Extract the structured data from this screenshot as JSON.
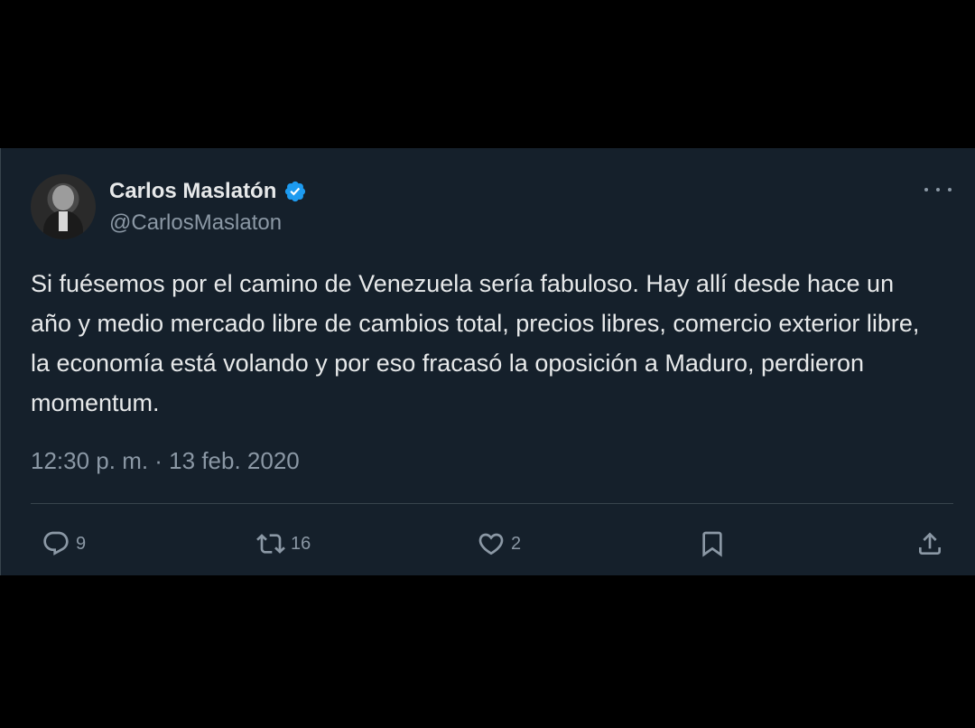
{
  "author": {
    "display_name": "Carlos Maslatón",
    "handle": "@CarlosMaslaton",
    "verified": true,
    "verified_color": "#1d9bf0"
  },
  "tweet": {
    "text": "Si fuésemos por el camino de Venezuela sería fabuloso. Hay allí desde hace un año y medio mercado libre de cambios total, precios libres, comercio exterior libre, la economía está volando y por eso fracasó la oposición a Maduro, perdieron momentum.",
    "timestamp": "12:30 p. m. · 13 feb. 2020"
  },
  "actions": {
    "reply_icon": "reply-icon",
    "reply_count": "9",
    "retweet_icon": "retweet-icon",
    "retweet_count": "16",
    "like_icon": "heart-icon",
    "like_count": "2",
    "bookmark_icon": "bookmark-icon",
    "share_icon": "share-icon"
  },
  "colors": {
    "background": "#15202b",
    "text_primary": "#e7e9ea",
    "text_secondary": "#8b98a5",
    "divider": "#38444d"
  }
}
